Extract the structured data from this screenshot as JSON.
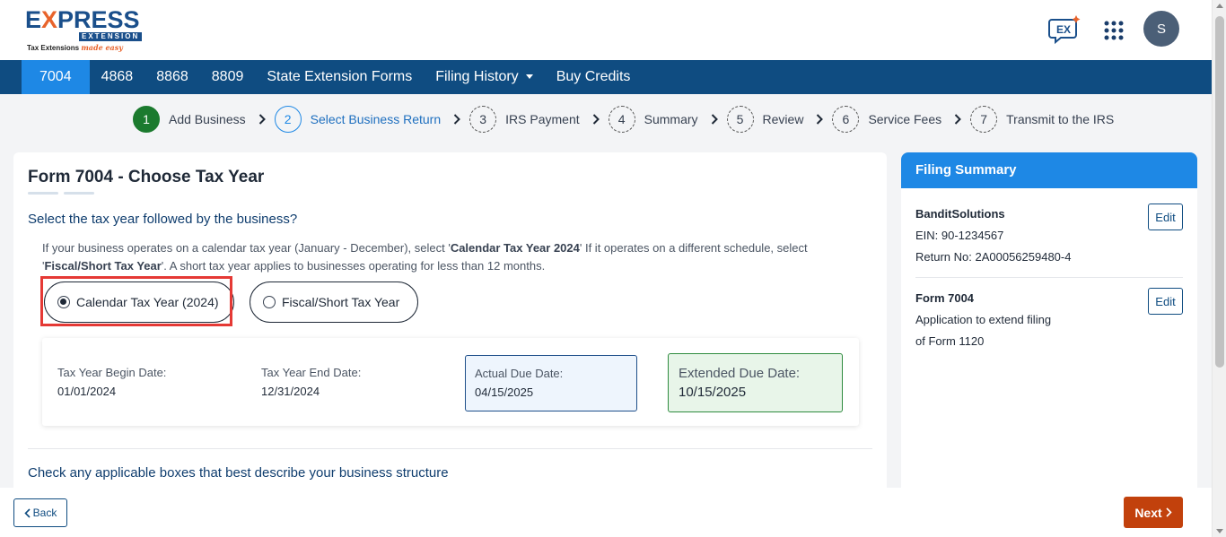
{
  "brand": {
    "logo_word": "EXPRESS",
    "logo_sub": "EXTENSION",
    "tagline_start": "Tax Extensions",
    "tagline_end": "made easy"
  },
  "header": {
    "avatar_initial": "S",
    "chat_icon": "chat-ex-icon",
    "apps_icon": "apps-grid-icon"
  },
  "nav": {
    "items": [
      {
        "label": "7004",
        "active": true
      },
      {
        "label": "4868"
      },
      {
        "label": "8868"
      },
      {
        "label": "8809"
      },
      {
        "label": "State Extension Forms"
      },
      {
        "label": "Filing History",
        "dropdown": true
      },
      {
        "label": "Buy Credits"
      }
    ]
  },
  "steps": [
    {
      "num": "1",
      "label": "Add Business",
      "state": "done"
    },
    {
      "num": "2",
      "label": "Select Business Return",
      "state": "current"
    },
    {
      "num": "3",
      "label": "IRS Payment"
    },
    {
      "num": "4",
      "label": "Summary"
    },
    {
      "num": "5",
      "label": "Review"
    },
    {
      "num": "6",
      "label": "Service Fees"
    },
    {
      "num": "7",
      "label": "Transmit to the IRS"
    }
  ],
  "main": {
    "title": "Form 7004 - Choose Tax Year",
    "question": "Select the tax year followed by the business?",
    "desc_1": "If your business operates on a calendar tax year (January - December), select '",
    "desc_b1": "Calendar Tax Year 2024",
    "desc_2": "' If it operates on a different schedule, select '",
    "desc_b2": "Fiscal/Short Tax Year",
    "desc_3": "'. A short tax year applies to businesses operating for less than 12 months.",
    "option_calendar": "Calendar Tax Year (2024)",
    "option_fiscal": "Fiscal/Short Tax Year",
    "begin_label": "Tax Year Begin Date:",
    "begin_value": "01/01/2024",
    "end_label": "Tax Year End Date:",
    "end_value": "12/31/2024",
    "actual_label": "Actual Due Date:",
    "actual_value": "04/15/2025",
    "extended_label": "Extended Due Date:",
    "extended_value": "10/15/2025",
    "question_2": "Check any applicable boxes that best describe your business structure"
  },
  "summary": {
    "title": "Filing Summary",
    "business_name": "BanditSolutions",
    "ein": "EIN: 90-1234567",
    "return_no": "Return No: 2A00056259480-4",
    "form_name": "Form 7004",
    "form_desc_1": "Application to extend filing",
    "form_desc_2": "of Form 1120",
    "edit_label": "Edit"
  },
  "footer": {
    "back_label": "Back",
    "next_label": "Next"
  },
  "colors": {
    "nav_bg": "#0f4c81",
    "nav_active": "#1e88e5",
    "step_done": "#1b7a2e",
    "next_btn": "#c2410c",
    "highlight": "#e53935"
  }
}
